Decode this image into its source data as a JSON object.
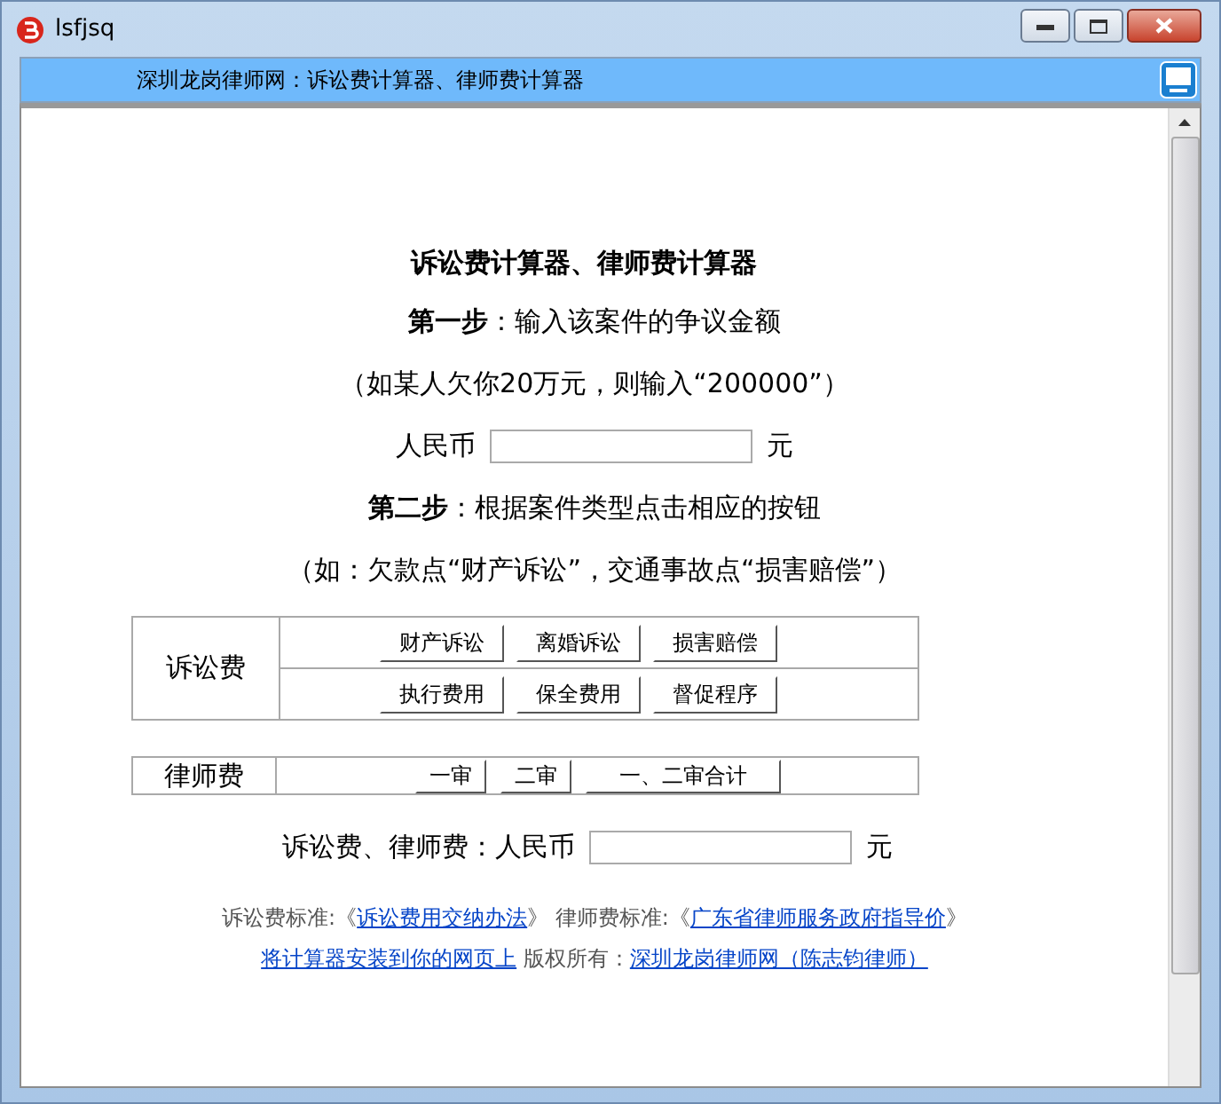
{
  "window": {
    "title": "lsfjsq"
  },
  "header": {
    "title": "深圳龙岗律师网：诉讼费计算器、律师费计算器"
  },
  "calculator": {
    "title": "诉讼费计算器、律师费计算器",
    "step1": "**第一步**：输入该案件的争议金额",
    "step1_hint": "（如某人欠你20万元，则输入“200000”）",
    "amount": {
      "label": "人民币",
      "unit": "元"
    },
    "step2": "**第二步**：根据案件类型点击相应的按钮",
    "step2_hint": "（如：欠款点“财产诉讼”，交通事故点“损害赔偿”）",
    "litigation_fee": {
      "label": "诉讼费",
      "button_rows": [
        [
          "财产诉讼",
          "离婚诉讼",
          "损害赔偿"
        ],
        [
          "执行费用",
          "保全费用",
          "督促程序"
        ]
      ]
    },
    "lawyer_fee": {
      "label": "律师费",
      "buttons": [
        "一审",
        "二审",
        "一、二审合计"
      ]
    },
    "result": {
      "label": "诉讼费、律师费：人民币",
      "unit": "元"
    }
  },
  "footer": [
    [
      {
        "kind": "text",
        "text": "诉讼费标准:《"
      },
      {
        "kind": "link",
        "text": "诉讼费用交纳办法"
      },
      {
        "kind": "text",
        "text": "》 律师费标准:《"
      },
      {
        "kind": "link",
        "text": "广东省律师服务政府指导价"
      },
      {
        "kind": "text",
        "text": "》"
      }
    ],
    [
      {
        "kind": "link",
        "text": "将计算器安装到你的网页上"
      },
      {
        "kind": "text",
        "text": " 版权所有："
      },
      {
        "kind": "link",
        "text": "深圳龙岗律师网（陈志钧律师）"
      }
    ]
  ]
}
